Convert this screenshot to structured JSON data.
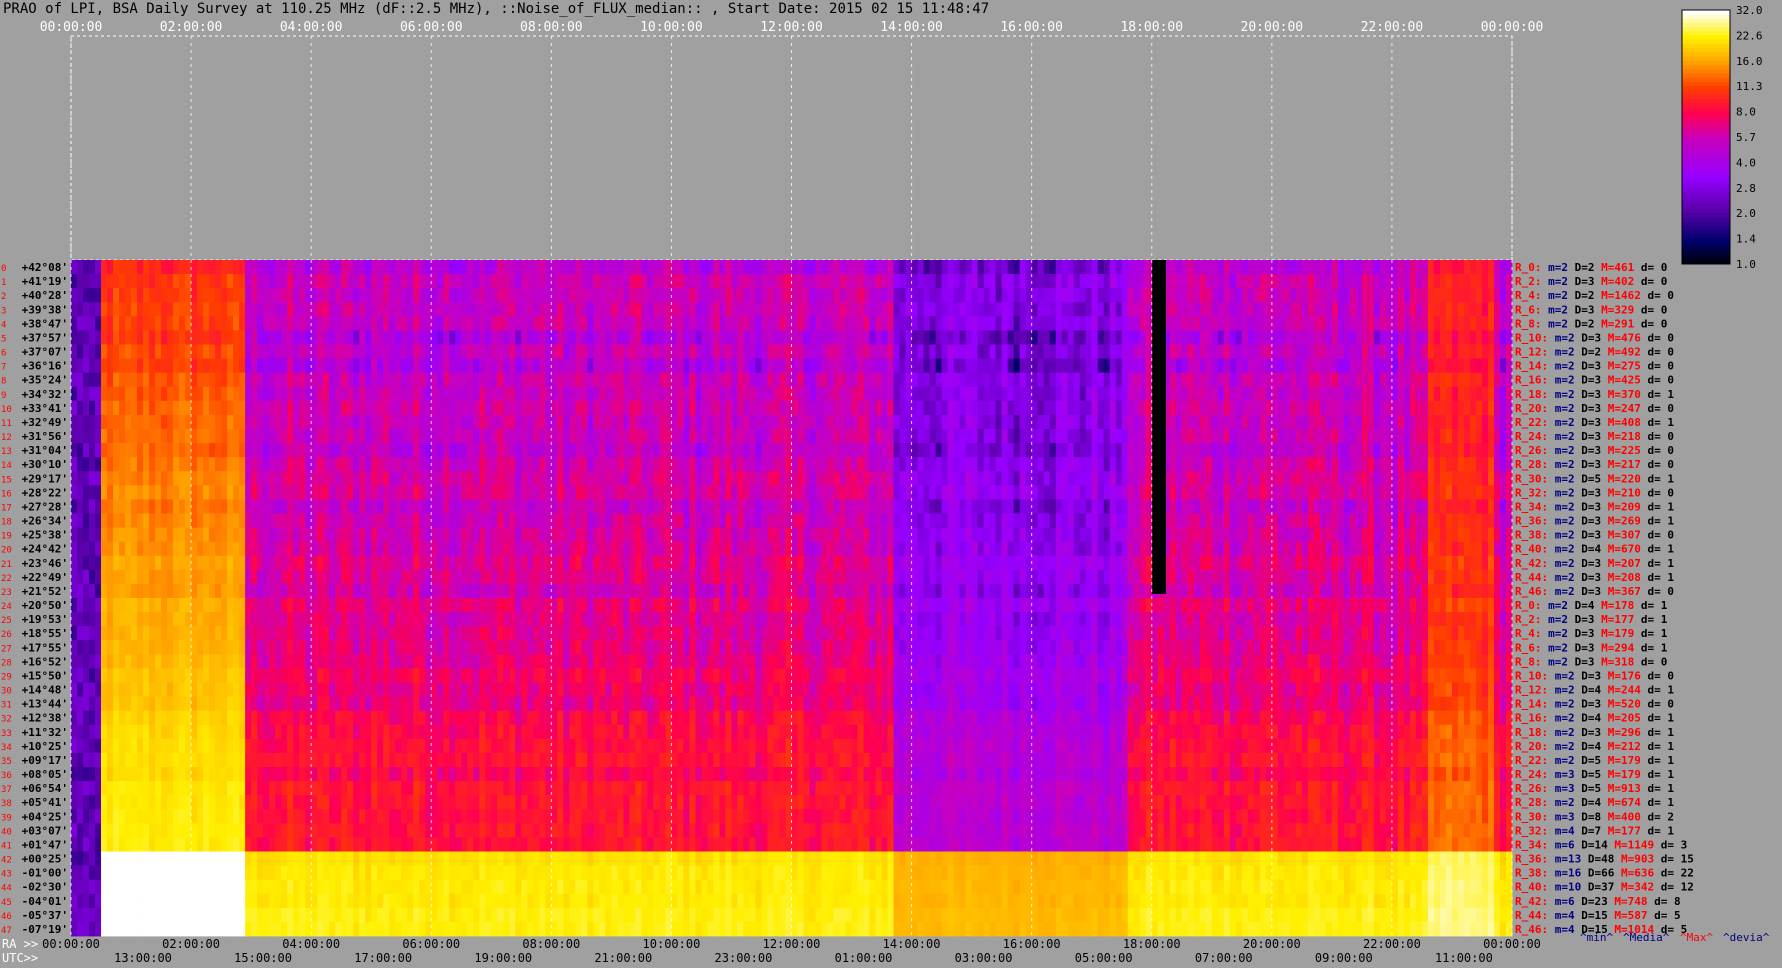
{
  "title": "PRAO of LPI, BSA Daily Survey at 110.25 MHz (dF::2.5 MHz), ::Noise_of_FLUX_median:: , Start Date: 2015 02 15 11:48:47",
  "chart_data": {
    "type": "heatmap",
    "top_time_labels": [
      "00:00:00",
      "02:00:00",
      "04:00:00",
      "06:00:00",
      "08:00:00",
      "10:00:00",
      "12:00:00",
      "14:00:00",
      "16:00:00",
      "18:00:00",
      "20:00:00",
      "22:00:00",
      "00:00:00"
    ],
    "ra_label": "RA >>",
    "ra_ticks": [
      "00:00:00",
      "02:00:00",
      "04:00:00",
      "06:00:00",
      "08:00:00",
      "10:00:00",
      "12:00:00",
      "14:00:00",
      "16:00:00",
      "18:00:00",
      "20:00:00",
      "22:00:00",
      "00:00:00"
    ],
    "utc_label": "UTC>>",
    "utc_ticks": [
      "13:00:00",
      "15:00:00",
      "17:00:00",
      "19:00:00",
      "21:00:00",
      "23:00:00",
      "01:00:00",
      "03:00:00",
      "05:00:00",
      "07:00:00",
      "09:00:00",
      "11:00:00"
    ],
    "colorbar_ticks": [
      "32.0",
      "22.6",
      "16.0",
      "11.3",
      "8.0",
      "5.7",
      "4.0",
      "2.8",
      "2.0",
      "1.4",
      "1.0"
    ],
    "colorbar_range": [
      1.0,
      32.0
    ],
    "declinations": [
      "+42°08'",
      "+41°19'",
      "+40°28'",
      "+39°38'",
      "+38°47'",
      "+37°57'",
      "+37°07'",
      "+36°16'",
      "+35°24'",
      "+34°32'",
      "+33°41'",
      "+32°49'",
      "+31°56'",
      "+31°04'",
      "+30°10'",
      "+29°17'",
      "+28°22'",
      "+27°28'",
      "+26°34'",
      "+25°38'",
      "+24°42'",
      "+23°46'",
      "+22°49'",
      "+21°52'",
      "+20°50'",
      "+19°53'",
      "+18°55'",
      "+17°55'",
      "+16°52'",
      "+15°50'",
      "+14°48'",
      "+13°44'",
      "+12°38'",
      "+11°32'",
      "+10°25'",
      "+09°17'",
      "+08°05'",
      "+06°54'",
      "+05°41'",
      "+04°25'",
      "+03°07'",
      "+01°47'",
      "+00°25'",
      "-01°00'",
      "-02°30'",
      "-04°01'",
      "-05°37'",
      "-07°19'"
    ],
    "row_stats": [
      {
        "r": "R_0:",
        "m": "m=2",
        "D": "D=2",
        "M": "M=461",
        "d": "d= 0"
      },
      {
        "r": "R_2:",
        "m": "m=2",
        "D": "D=3",
        "M": "M=402",
        "d": "d= 0"
      },
      {
        "r": "R_4:",
        "m": "m=2",
        "D": "D=2",
        "M": "M=1462",
        "d": "d= 0"
      },
      {
        "r": "R_6:",
        "m": "m=2",
        "D": "D=3",
        "M": "M=329",
        "d": "d= 0"
      },
      {
        "r": "R_8:",
        "m": "m=2",
        "D": "D=2",
        "M": "M=291",
        "d": "d= 0"
      },
      {
        "r": "R_10:",
        "m": "m=2",
        "D": "D=3",
        "M": "M=476",
        "d": "d= 0"
      },
      {
        "r": "R_12:",
        "m": "m=2",
        "D": "D=2",
        "M": "M=492",
        "d": "d= 0"
      },
      {
        "r": "R_14:",
        "m": "m=2",
        "D": "D=3",
        "M": "M=275",
        "d": "d= 0"
      },
      {
        "r": "R_16:",
        "m": "m=2",
        "D": "D=3",
        "M": "M=425",
        "d": "d= 0"
      },
      {
        "r": "R_18:",
        "m": "m=2",
        "D": "D=3",
        "M": "M=370",
        "d": "d= 1"
      },
      {
        "r": "R_20:",
        "m": "m=2",
        "D": "D=3",
        "M": "M=247",
        "d": "d= 0"
      },
      {
        "r": "R_22:",
        "m": "m=2",
        "D": "D=3",
        "M": "M=408",
        "d": "d= 1"
      },
      {
        "r": "R_24:",
        "m": "m=2",
        "D": "D=3",
        "M": "M=218",
        "d": "d= 0"
      },
      {
        "r": "R_26:",
        "m": "m=2",
        "D": "D=3",
        "M": "M=225",
        "d": "d= 0"
      },
      {
        "r": "R_28:",
        "m": "m=2",
        "D": "D=3",
        "M": "M=217",
        "d": "d= 0"
      },
      {
        "r": "R_30:",
        "m": "m=2",
        "D": "D=5",
        "M": "M=220",
        "d": "d= 1"
      },
      {
        "r": "R_32:",
        "m": "m=2",
        "D": "D=3",
        "M": "M=210",
        "d": "d= 0"
      },
      {
        "r": "R_34:",
        "m": "m=2",
        "D": "D=3",
        "M": "M=209",
        "d": "d= 1"
      },
      {
        "r": "R_36:",
        "m": "m=2",
        "D": "D=3",
        "M": "M=269",
        "d": "d= 1"
      },
      {
        "r": "R_38:",
        "m": "m=2",
        "D": "D=3",
        "M": "M=307",
        "d": "d= 0"
      },
      {
        "r": "R_40:",
        "m": "m=2",
        "D": "D=4",
        "M": "M=670",
        "d": "d= 1"
      },
      {
        "r": "R_42:",
        "m": "m=2",
        "D": "D=3",
        "M": "M=207",
        "d": "d= 1"
      },
      {
        "r": "R_44:",
        "m": "m=2",
        "D": "D=3",
        "M": "M=208",
        "d": "d= 1"
      },
      {
        "r": "R_46:",
        "m": "m=2",
        "D": "D=3",
        "M": "M=367",
        "d": "d= 0"
      },
      {
        "r": "R_0:",
        "m": "m=2",
        "D": "D=4",
        "M": "M=178",
        "d": "d= 1"
      },
      {
        "r": "R_2:",
        "m": "m=2",
        "D": "D=3",
        "M": "M=177",
        "d": "d= 1"
      },
      {
        "r": "R_4:",
        "m": "m=2",
        "D": "D=3",
        "M": "M=179",
        "d": "d= 1"
      },
      {
        "r": "R_6:",
        "m": "m=2",
        "D": "D=3",
        "M": "M=294",
        "d": "d= 1"
      },
      {
        "r": "R_8:",
        "m": "m=2",
        "D": "D=3",
        "M": "M=318",
        "d": "d= 0"
      },
      {
        "r": "R_10:",
        "m": "m=2",
        "D": "D=3",
        "M": "M=176",
        "d": "d= 0"
      },
      {
        "r": "R_12:",
        "m": "m=2",
        "D": "D=4",
        "M": "M=244",
        "d": "d= 1"
      },
      {
        "r": "R_14:",
        "m": "m=2",
        "D": "D=3",
        "M": "M=520",
        "d": "d= 0"
      },
      {
        "r": "R_16:",
        "m": "m=2",
        "D": "D=4",
        "M": "M=205",
        "d": "d= 1"
      },
      {
        "r": "R_18:",
        "m": "m=2",
        "D": "D=3",
        "M": "M=296",
        "d": "d= 1"
      },
      {
        "r": "R_20:",
        "m": "m=2",
        "D": "D=4",
        "M": "M=212",
        "d": "d= 1"
      },
      {
        "r": "R_22:",
        "m": "m=2",
        "D": "D=5",
        "M": "M=179",
        "d": "d= 1"
      },
      {
        "r": "R_24:",
        "m": "m=3",
        "D": "D=5",
        "M": "M=179",
        "d": "d= 1"
      },
      {
        "r": "R_26:",
        "m": "m=3",
        "D": "D=5",
        "M": "M=913",
        "d": "d= 1"
      },
      {
        "r": "R_28:",
        "m": "m=2",
        "D": "D=4",
        "M": "M=674",
        "d": "d= 1"
      },
      {
        "r": "R_30:",
        "m": "m=3",
        "D": "D=8",
        "M": "M=400",
        "d": "d= 2"
      },
      {
        "r": "R_32:",
        "m": "m=4",
        "D": "D=7",
        "M": "M=177",
        "d": "d= 1"
      },
      {
        "r": "R_34:",
        "m": "m=6",
        "D": "D=14",
        "M": "M=1149",
        "d": "d= 3"
      },
      {
        "r": "R_36:",
        "m": "m=13",
        "D": "D=48",
        "M": "M=903",
        "d": "d= 15"
      },
      {
        "r": "R_38:",
        "m": "m=16",
        "D": "D=66",
        "M": "M=636",
        "d": "d= 22"
      },
      {
        "r": "R_40:",
        "m": "m=10",
        "D": "D=37",
        "M": "M=342",
        "d": "d= 12"
      },
      {
        "r": "R_42:",
        "m": "m=6",
        "D": "D=23",
        "M": "M=748",
        "d": "d= 8"
      },
      {
        "r": "R_44:",
        "m": "m=4",
        "D": "D=15",
        "M": "M=587",
        "d": "d= 5"
      },
      {
        "r": "R_46:",
        "m": "m=4",
        "D": "D=15",
        "M": "M=1014",
        "d": "d= 5"
      }
    ],
    "legend": [
      {
        "text": "^min^",
        "color": "#000080"
      },
      {
        "text": "^Media^",
        "color": "#000080"
      },
      {
        "text": "^Max^",
        "color": "#ff0000"
      },
      {
        "text": "^devia^",
        "color": "#000080"
      }
    ],
    "colors": {
      "background": "#a0a0a0",
      "label_red": "#ff0000",
      "label_navy": "#000080",
      "dec_black": "#000000"
    }
  }
}
